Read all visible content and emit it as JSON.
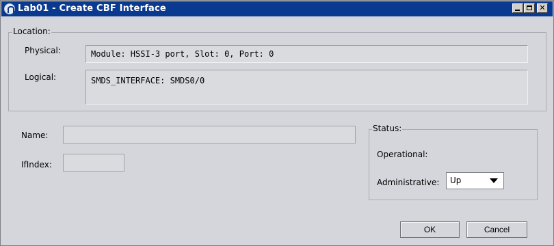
{
  "window": {
    "title": "Lab01 - Create CBF Interface"
  },
  "location": {
    "group_label": "Location:",
    "physical_label": "Physical:",
    "physical_value": "Module: HSSI-3 port, Slot: 0, Port: 0",
    "logical_label": "Logical:",
    "logical_value": "SMDS_INTERFACE: SMDS0/0"
  },
  "form": {
    "name_label": "Name:",
    "name_value": "",
    "ifindex_label": "IfIndex:",
    "ifindex_value": ""
  },
  "status": {
    "group_label": "Status:",
    "operational_label": "Operational:",
    "operational_value": "",
    "administrative_label": "Administrative:",
    "administrative_value": "Up"
  },
  "buttons": {
    "ok_label": "OK",
    "cancel_label": "Cancel"
  },
  "icons": {
    "window_icon": "app-logo-icon",
    "minimize": "minimize-icon",
    "maximize": "maximize-icon",
    "close": "close-icon"
  }
}
